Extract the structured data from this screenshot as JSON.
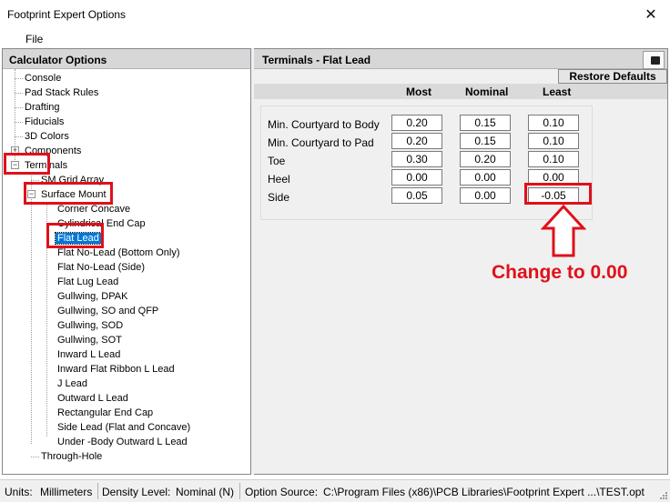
{
  "window": {
    "title": "Footprint Expert Options"
  },
  "menu": {
    "file": "File"
  },
  "left_panel": {
    "header": "Calculator Options",
    "tree": [
      {
        "label": "Console"
      },
      {
        "label": "Pad Stack Rules"
      },
      {
        "label": "Drafting"
      },
      {
        "label": "Fiducials"
      },
      {
        "label": "3D Colors"
      },
      {
        "label": "Components"
      },
      {
        "label": "Terminals"
      },
      {
        "label": "SM Grid Array"
      },
      {
        "label": "Surface Mount"
      },
      {
        "label": "Corner Concave"
      },
      {
        "label": "Cylindrical End Cap"
      },
      {
        "label": "Flat Lead"
      },
      {
        "label": "Flat No-Lead (Bottom Only)"
      },
      {
        "label": "Flat No-Lead (Side)"
      },
      {
        "label": "Flat Lug Lead"
      },
      {
        "label": "Gullwing, DPAK"
      },
      {
        "label": "Gullwing, SO and QFP"
      },
      {
        "label": "Gullwing, SOD"
      },
      {
        "label": "Gullwing, SOT"
      },
      {
        "label": "Inward L Lead"
      },
      {
        "label": "Inward Flat Ribbon L Lead"
      },
      {
        "label": "J Lead"
      },
      {
        "label": "Outward L Lead"
      },
      {
        "label": "Rectangular End Cap"
      },
      {
        "label": "Side Lead (Flat and Concave)"
      },
      {
        "label": "Under -Body Outward L Lead"
      },
      {
        "label": "Through-Hole"
      }
    ]
  },
  "right_panel": {
    "header": "Terminals - Flat Lead",
    "restore_defaults": "Restore Defaults",
    "columns": {
      "most": "Most",
      "nominal": "Nominal",
      "least": "Least"
    },
    "rows": [
      {
        "label": "Min. Courtyard to Body",
        "most": "0.20",
        "nominal": "0.15",
        "least": "0.10"
      },
      {
        "label": "Min. Courtyard to Pad",
        "most": "0.20",
        "nominal": "0.15",
        "least": "0.10"
      },
      {
        "label": "Toe",
        "most": "0.30",
        "nominal": "0.20",
        "least": "0.10"
      },
      {
        "label": "Heel",
        "most": "0.00",
        "nominal": "0.00",
        "least": "0.00"
      },
      {
        "label": "Side",
        "most": "0.05",
        "nominal": "0.00",
        "least": "-0.05"
      }
    ]
  },
  "annotation": {
    "text": "Change to 0.00",
    "color": "#e0101a"
  },
  "status": {
    "units_label": "Units:",
    "units_value": "Millimeters",
    "density_label": "Density Level:",
    "density_value": "Nominal (N)",
    "option_source_label": "Option Source:",
    "option_source_value": "C:\\Program Files (x86)\\PCB Libraries\\Footprint Expert ...\\TEST.opt"
  }
}
